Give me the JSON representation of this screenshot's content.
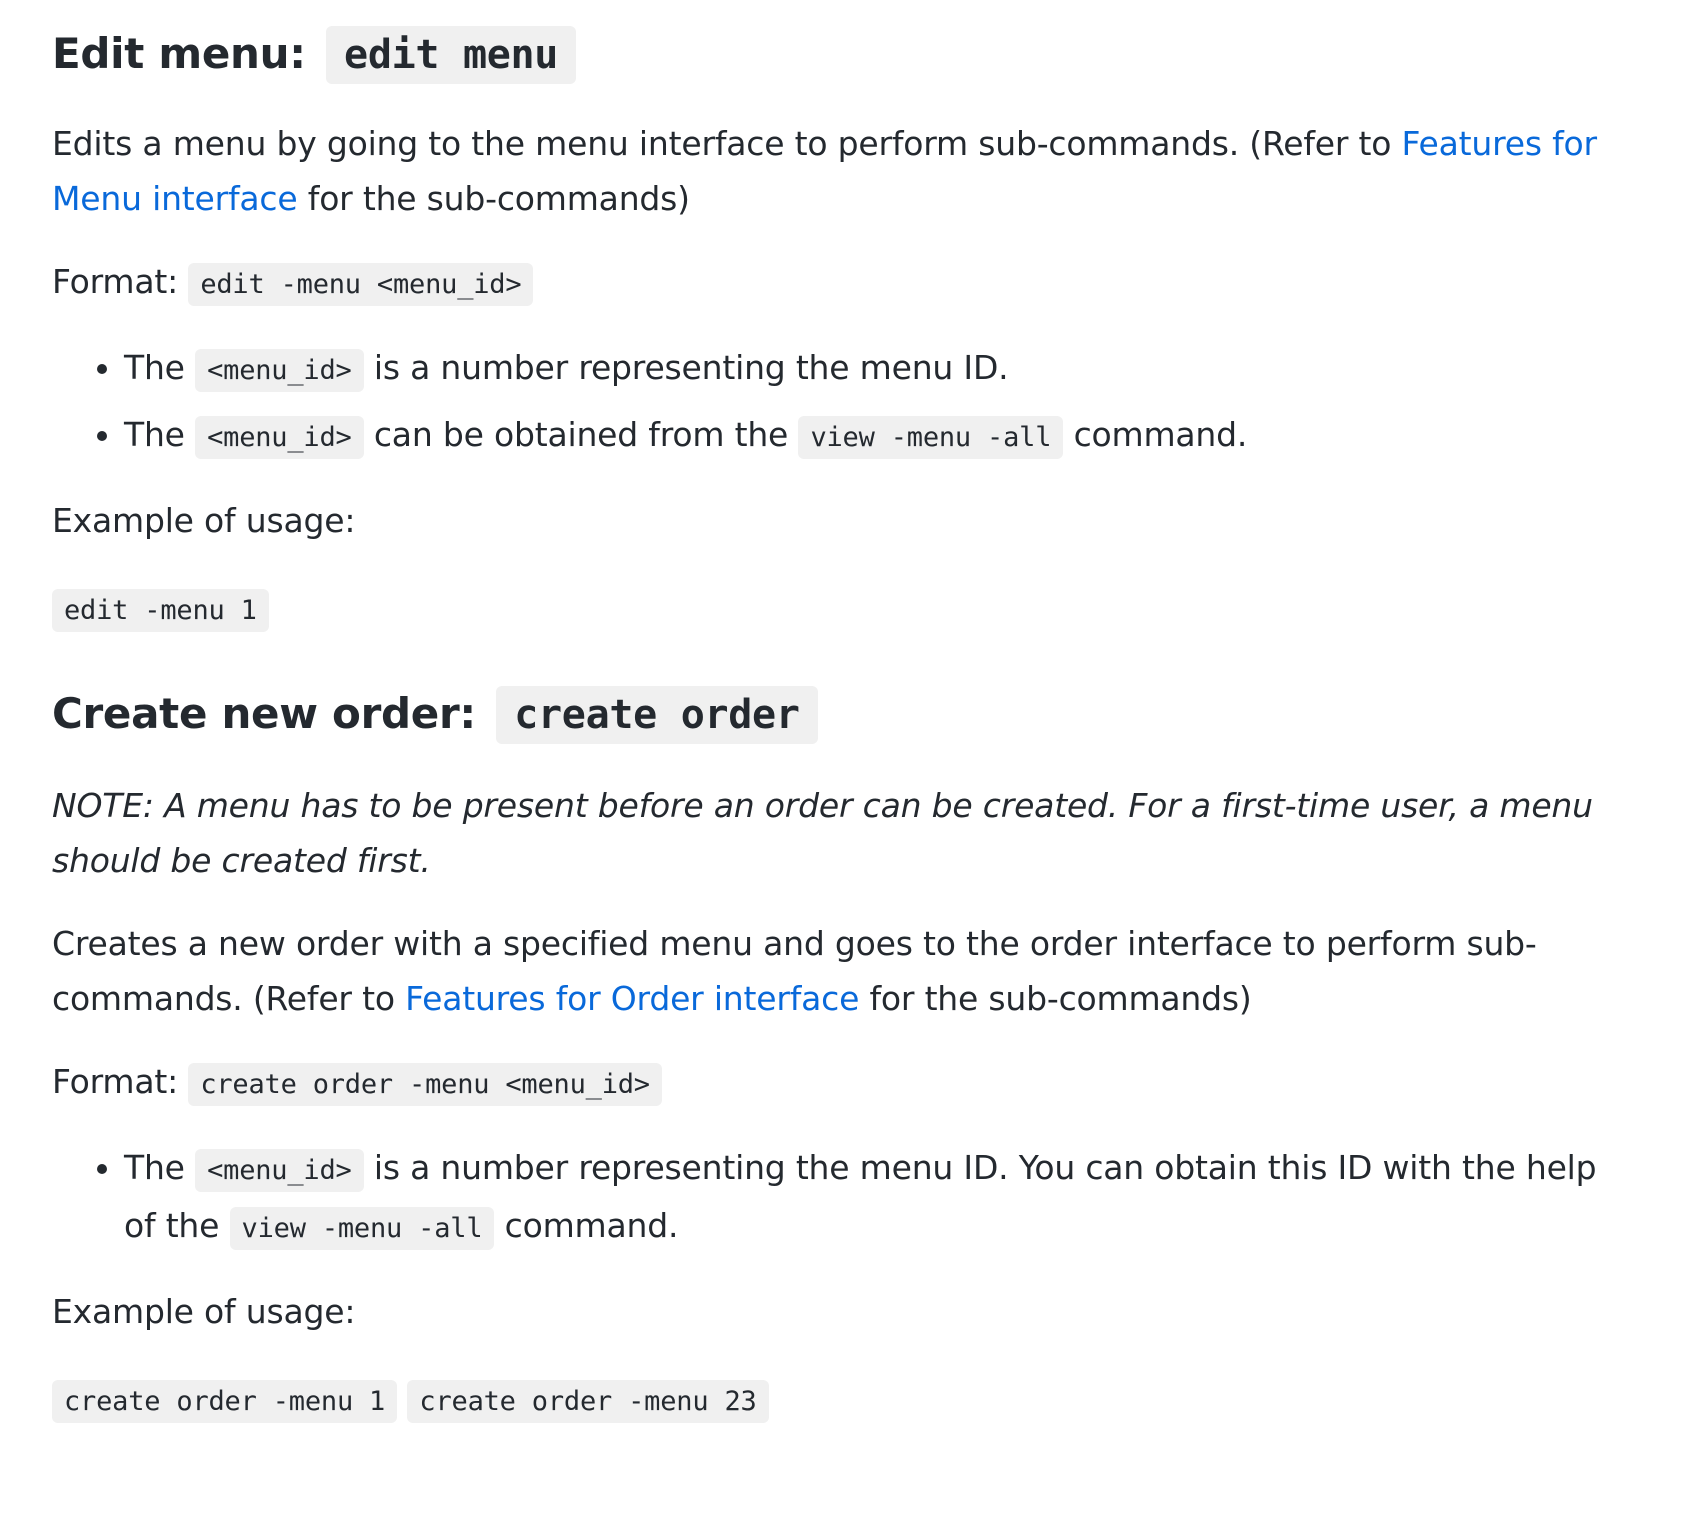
{
  "edit_menu": {
    "heading": "Edit menu:",
    "heading_code": "edit menu",
    "desc_before": "Edits a menu by going to the menu interface to perform sub-commands. (Refer to ",
    "desc_link": "Features for Menu interface",
    "desc_after": " for the sub-commands)",
    "format_label": "Format: ",
    "format_code": "edit -menu <menu_id>",
    "bullets": [
      {
        "before": "The ",
        "code": "<menu_id>",
        "after": " is a number representing the menu ID."
      },
      {
        "before": "The ",
        "code": "<menu_id>",
        "middle": " can be obtained from the ",
        "code2": "view -menu -all",
        "after": " command."
      }
    ],
    "example_label": "Example of usage:",
    "example_code": "edit -menu 1"
  },
  "create_order": {
    "heading": "Create new order:",
    "heading_code": "create order",
    "note": "NOTE: A menu has to be present before an order can be created. For a first-time user, a menu should be created first.",
    "desc_before": "Creates a new order with a specified menu and goes to the order interface to perform sub-commands. (Refer to ",
    "desc_link": "Features for Order interface",
    "desc_after": " for the sub-commands)",
    "format_label": "Format: ",
    "format_code": "create order -menu <menu_id>",
    "bullets": [
      {
        "before": "The ",
        "code": "<menu_id>",
        "middle": " is a number representing the menu ID. You can obtain this ID with the help of the ",
        "code2": "view -menu -all",
        "after": " command."
      }
    ],
    "example_label": "Example of usage:",
    "example_codes": [
      "create order -menu 1",
      "create order -menu 23"
    ]
  }
}
